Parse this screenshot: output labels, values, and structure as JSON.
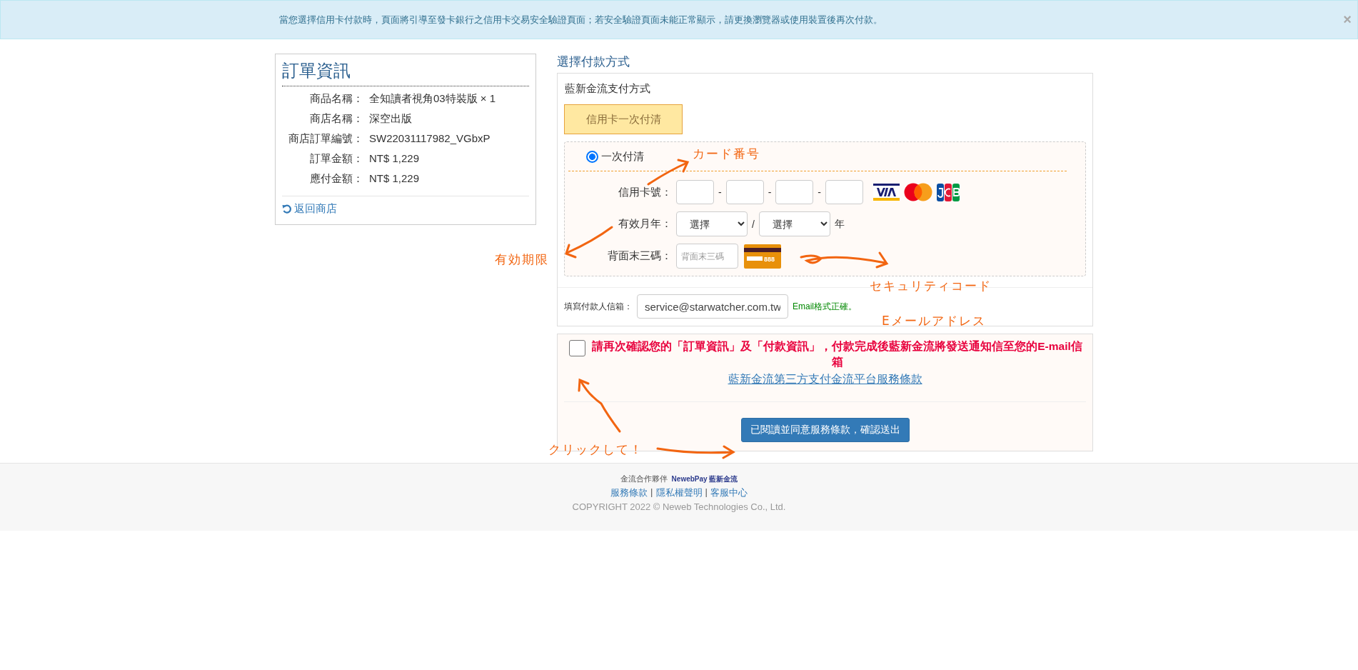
{
  "notice": {
    "text": "當您選擇信用卡付款時，頁面將引導至發卡銀行之信用卡交易安全驗證頁面；若安全驗證頁面未能正常顯示，請更換瀏覽器或使用裝置後再次付款。",
    "close": "×"
  },
  "order": {
    "title": "訂單資訊",
    "rows": [
      {
        "label": "商品名稱：",
        "value": "全知讀者視角03特裝版 × 1"
      },
      {
        "label": "商店名稱：",
        "value": "深空出版"
      },
      {
        "label": "商店訂單編號：",
        "value": "SW22031117982_VGbxP"
      },
      {
        "label": "訂單金額：",
        "value": "NT$ 1,229"
      },
      {
        "label": "應付金額：",
        "value": "NT$ 1,229"
      }
    ],
    "back_link": "返回商店"
  },
  "payment": {
    "heading": "選擇付款方式",
    "provider": "藍新金流支付方式",
    "tabs": [
      {
        "label": "信用卡一次付清",
        "selected": true
      }
    ],
    "options": [
      {
        "label": "一次付清",
        "selected": true
      }
    ],
    "card_number": {
      "label": "信用卡號：",
      "separators": [
        "-",
        "-",
        "-"
      ]
    },
    "expiry": {
      "label": "有效月年：",
      "month": "選擇",
      "separator": "/",
      "year": "選擇",
      "suffix": "年"
    },
    "cvv": {
      "label": "背面末三碼：",
      "placeholder": "背面末三碼",
      "icon_text": "888"
    },
    "email": {
      "label": "填寫付款人信箱：",
      "value": "service@starwatcher.com.tw",
      "status": "Email格式正確。"
    }
  },
  "confirm": {
    "checked": false,
    "notice": "請再次確認您的「訂單資訊」及「付款資訊」，付款完成後藍新金流將發送通知信至您的E-mail信箱",
    "terms_link": "藍新金流第三方支付金流平台服務條款",
    "submit": "已閱讀並同意服務條款，確認送出"
  },
  "footer": {
    "partner_label": "金流合作夥伴",
    "partner_logo": "NewebPay 藍新金流",
    "links": [
      "服務條款",
      "隱私權聲明",
      "客服中心"
    ],
    "separators": [
      "|",
      "|"
    ],
    "copyright": "COPYRIGHT 2022 © Neweb Technologies Co., Ltd."
  },
  "annotations": [
    {
      "text": "カード番号"
    },
    {
      "text": "有効期限"
    },
    {
      "text": "セキュリティコード"
    },
    {
      "text": "Eメールアドレス"
    },
    {
      "text": "クリックして！"
    }
  ]
}
